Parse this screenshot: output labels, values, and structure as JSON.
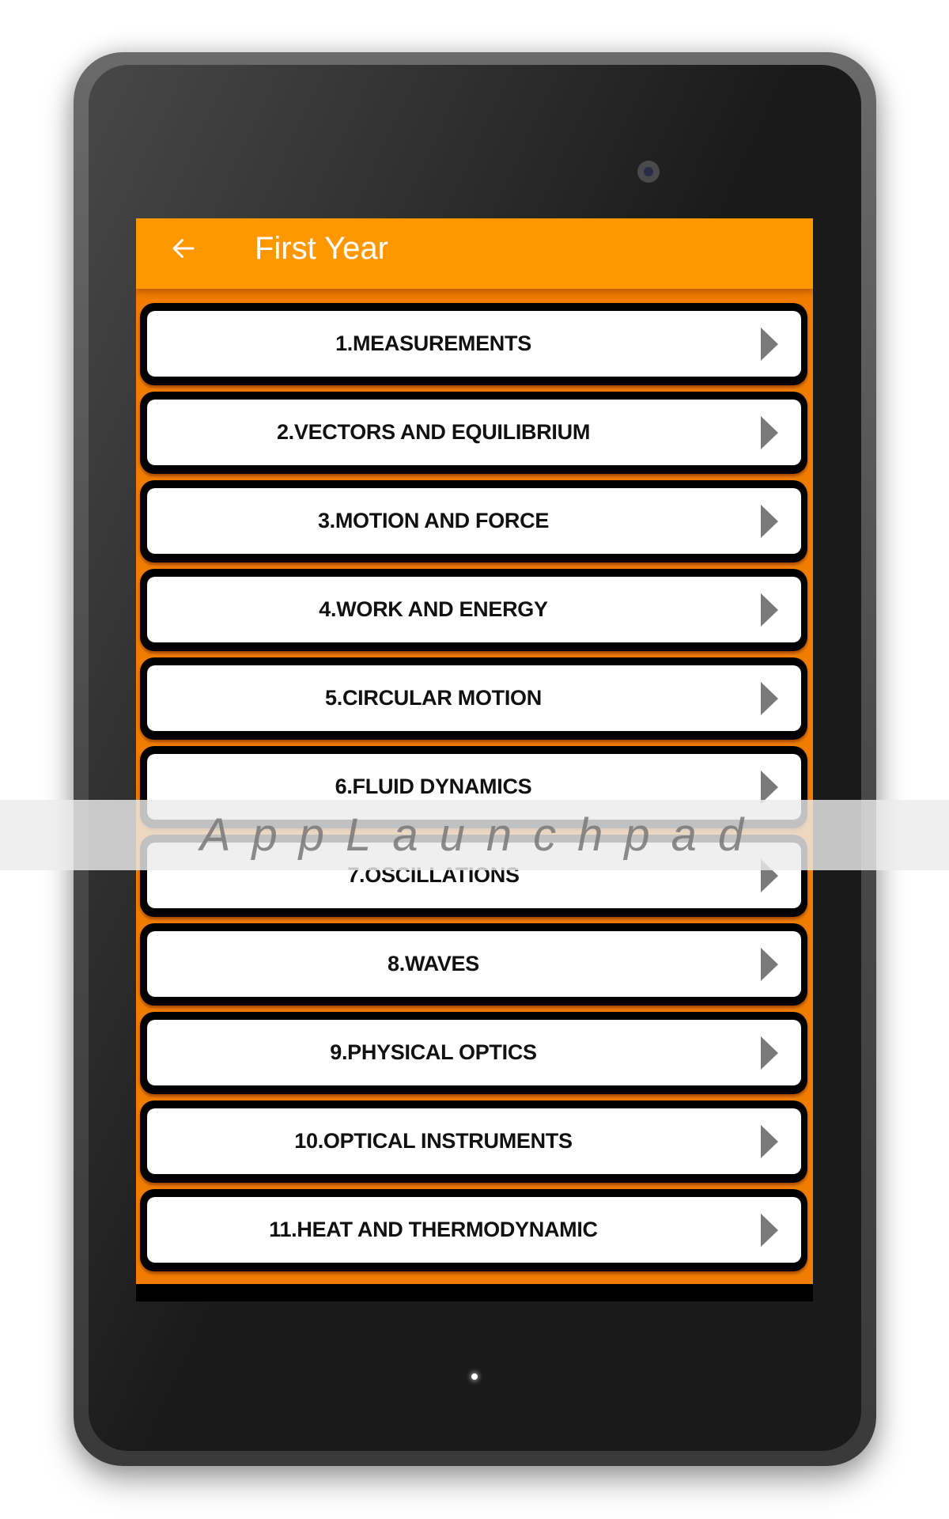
{
  "app_bar": {
    "title": "First Year",
    "back_icon": "arrow-left-icon",
    "background_color": "#FF9800"
  },
  "chapters": [
    {
      "label": "1.MEASUREMENTS",
      "icon": "chevron-right-icon"
    },
    {
      "label": "2.VECTORS AND EQUILIBRIUM",
      "icon": "chevron-right-icon"
    },
    {
      "label": "3.MOTION AND FORCE",
      "icon": "chevron-right-icon"
    },
    {
      "label": "4.WORK AND ENERGY",
      "icon": "chevron-right-icon"
    },
    {
      "label": "5.CIRCULAR MOTION",
      "icon": "chevron-right-icon"
    },
    {
      "label": "6.FLUID DYNAMICS",
      "icon": "chevron-right-icon"
    },
    {
      "label": "7.OSCILLATIONS",
      "icon": "chevron-right-icon"
    },
    {
      "label": "8.WAVES",
      "icon": "chevron-right-icon"
    },
    {
      "label": "9.PHYSICAL OPTICS",
      "icon": "chevron-right-icon"
    },
    {
      "label": "10.OPTICAL INSTRUMENTS",
      "icon": "chevron-right-icon"
    },
    {
      "label": "11.HEAT AND THERMODYNAMIC",
      "icon": "chevron-right-icon"
    }
  ],
  "theme": {
    "list_background": "#F07C00",
    "card_border": "#000000",
    "card_fill": "#FFFFFF",
    "arrow_color": "#7A7A7A"
  },
  "watermark": {
    "text": "AppLaunchpad"
  }
}
